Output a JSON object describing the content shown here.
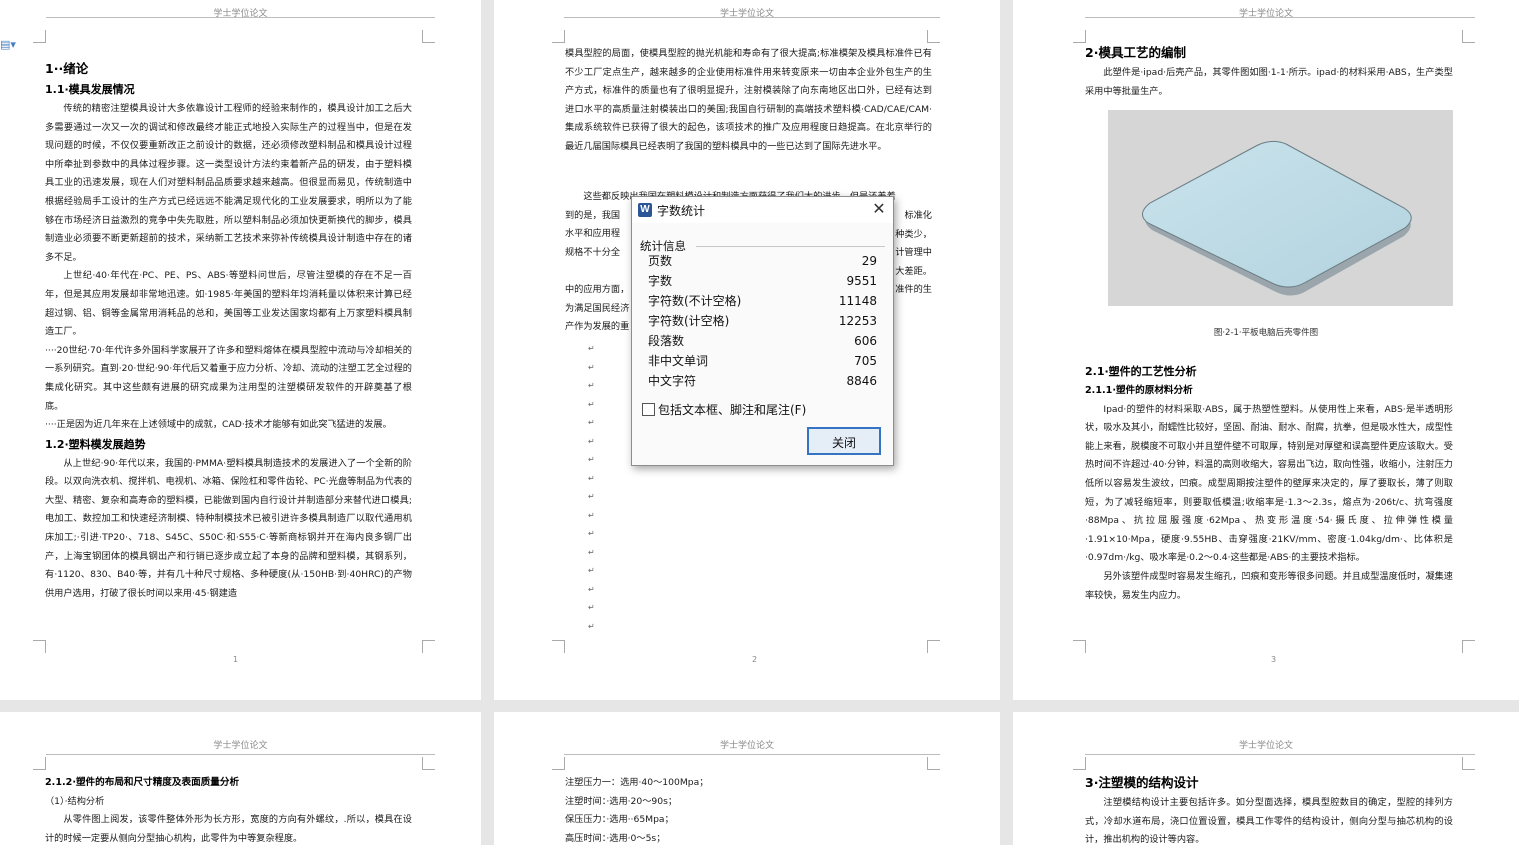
{
  "header_text": "学士学位论文",
  "page_numbers": [
    "1",
    "2",
    "3"
  ],
  "page1": {
    "h1": "1··绪论",
    "h2a": "1.1·模具发展情况",
    "p1": "传统的精密注塑模具设计大多依靠设计工程师的经验来制作的，模具设计加工之后大多需要通过一次又一次的调试和修改最终才能正式地投入实际生产的过程当中，但是在发现问题的时候，不仅仅要重新改正之前设计的数据，还必须修改塑料制品和模具设计过程中所牵扯到参数中的具体过程步骤。这一类型设计方法约束着新产品的研发，由于塑料模具工业的迅速发展，现在人们对塑料制品品质要求越来越高。但很显而易见，传统制造中根据经验局手工设计的生产方式已经远远不能满足现代化的工业发展要求，明所以为了能够在市场经济日益激烈的竞争中失先取胜，所以塑料制品必须加快更新换代的脚步，模具制造业必须要不断更新超前的技术，采纳新工艺技术来弥补传统模具设计制造中存在的诸多不足。",
    "p2": "上世纪·40·年代在·PC、PE、PS、ABS·等塑料问世后，尽管注塑模的存在不足一百年，但是其应用发展却非常地迅速。如·1985·年美国的塑料年均消耗量以体积来计算已经超过钢、铝、铜等金属常用消耗品的总和，美国等工业发达国家均都有上万家塑料模具制造工厂。",
    "p3": "····20世纪·70·年代许多外国科学家展开了许多和塑料熔体在模具型腔中流动与冷却相关的一系列研究。直到·20·世纪·90·年代后又着重于应力分析、冷却、流动的注塑工艺全过程的集成化研究。其中这些颇有进展的研究成果为注用型的注塑模研发软件的开辟奠基了根底。",
    "p4": "····正是因为近几年来在上述领域中的成就，CAD·技术才能够有如此突飞猛进的发展。",
    "h2b": "1.2·塑料模发展趋势",
    "p5": "从上世纪·90·年代以来，我国的·PMMA·塑料模具制造技术的发展进入了一个全新的阶段。以双向洗衣机、搅拌机、电视机、冰箱、保险杠和零件齿轮、PC·光盘等制品为代表的大型、精密、复杂和高寿命的塑料模，已能做到国内自行设计并制造部分来替代进口模具;电加工、数控加工和快速经济制模、特种制模技术已被引进许多模具制造厂以取代通用机床加工;·引进·TP20·、718、S45C、S50C·和·S55·C·等新商标钢并开在海内良多钢厂出产，上海宝钢团体的模具钢出产和行销已逐步成立起了本身的品牌和塑料模，其钢系列，有·1120、830、B40·等，并有几十种尺寸规格、多种硬度(从·150HB·到·40HRC)的产物供用户选用，打破了很长时间以来用·45·钢建造"
  },
  "page2": {
    "p1": "模具型腔的局面，使模具型腔的抛光机能和寿命有了很大提高;标准模架及模具标准件已有不少工厂定点生产，越来越多的企业使用标准件用来转变原来一切由本企业外包生产的生产方式，标准件的质量也有了很明显提升，注射模装除了向东南地区出口外，已经有达到进口水平的高质量注射模装出口的美国;我国自行研制的高端技术塑料模·CAD/CAE/CAM·集成系统软件已获得了很大的起色，该项技术的推广及应用程度日趋提高。在北京举行的最近几届国际模具已经表明了我国的塑料模具中的一些已达到了国际先进水平。",
    "p2a": "这些都反映出我国在塑料模设计和制造方面获得了我们大的进步，但是还差着",
    "p2b": "到的是，我国",
    "p2c": "水平和应用程",
    "p2d": "规格不十分全",
    "p2e": "中的应用方面，",
    "p2f": "为满足国民经济",
    "p2g": "产作为发展的重",
    "p2r1": "标准化",
    "p2r2": "种类少，",
    "p2r3": "计管理中",
    "p2r4": "大差距。",
    "p2r5": "准件的生"
  },
  "page3": {
    "h1": "2·模具工艺的编制",
    "p1": "此塑件是·ipad·后壳产品，其零件图如图·1-1·所示。ipad·的材料采用·ABS，生产类型采用中等批量生产。",
    "caption": "图·2-1·平板电脑后壳零件图",
    "h2": "2.1·塑件的工艺性分析",
    "h3": "2.1.1·塑件的原材料分析",
    "p2": "Ipad·的塑件的材料采取·ABS，属于热塑性塑料。从使用性上来看，ABS·是半透明形状，吸水及其小，耐蠕性比较好，坚固、耐油、耐水、耐腐，抗拳，但是吸水性大，成型性能上来看，脱模度不可取小并且塑件壁不可取厚，特别是对厚壁和误高塑件更应该取大。受热时间不许超过·40·分钟，料温的高则收缩大，容易出飞边，取向性强，收缩小，注射压力低所以容易发生波纹，凹痕。成型周期按注塑件的壁厚来决定的，厚了要取长，薄了则取短，为了减轻缩短率，则要取低模温;收缩率是·1.3～2.3s，熔点为·206t/c、抗弯强度·88Mpa、抗拉屈服强度·62Mpa、热变形温度·54·摄氏度、拉伸弹性模量·1.91×10·Mpa，硬度·9.55HB、击穿强度·21KV/mm、密度·1.04kg/dm·、比体积是·0.97dm·/kg、吸水率是·0.2～0.4·这些都是·ABS·的主要技术指标。",
    "p3": "另外该塑件成型时容易发生缩孔，凹痕和变形等很多问题。并且成型温度低时，凝集速率较快，易发生内应力。"
  },
  "page4": {
    "h3": "2.1.2·塑件的布局和尺寸精度及表面质量分析",
    "p1": "（1）·结构分析",
    "p2": "从零件图上阅发，该零件整体外形为长方形，宽度的方向有外螺纹，.所以，模具在设计的时候一定要从侧向分型抽心机构，此零件为中等复杂程度。"
  },
  "page5": {
    "l1": "注塑压力一：选用·40～100Mpa；",
    "l2": "注塑时间：·选用·20～90s；",
    "l3": "保压压力：·选用··65Mpa；",
    "l4": "高压时间：·选用·0～5s；"
  },
  "page6": {
    "h1": "3·注塑模的结构设计",
    "p1": "注塑模结构设计主要包括许多。如分型面选择，模具型腔数目的确定，型腔的排列方式，冷却水道布局，浇口位置设置，模具工作零件的结构设计，侧向分型与抽芯机构的设计，推出机构的设计等内容。"
  },
  "dialog": {
    "title": "字数统计",
    "group_label": "统计信息",
    "rows": [
      {
        "label": "页数",
        "value": "29"
      },
      {
        "label": "字数",
        "value": "9551"
      },
      {
        "label": "字符数(不计空格)",
        "value": "11148"
      },
      {
        "label": "字符数(计空格)",
        "value": "12253"
      },
      {
        "label": "段落数",
        "value": "606"
      },
      {
        "label": "非中文单词",
        "value": "705"
      },
      {
        "label": "中文字符",
        "value": "8846"
      }
    ],
    "checkbox_label": "包括文本框、脚注和尾注(F)",
    "close_button": "关闭"
  }
}
